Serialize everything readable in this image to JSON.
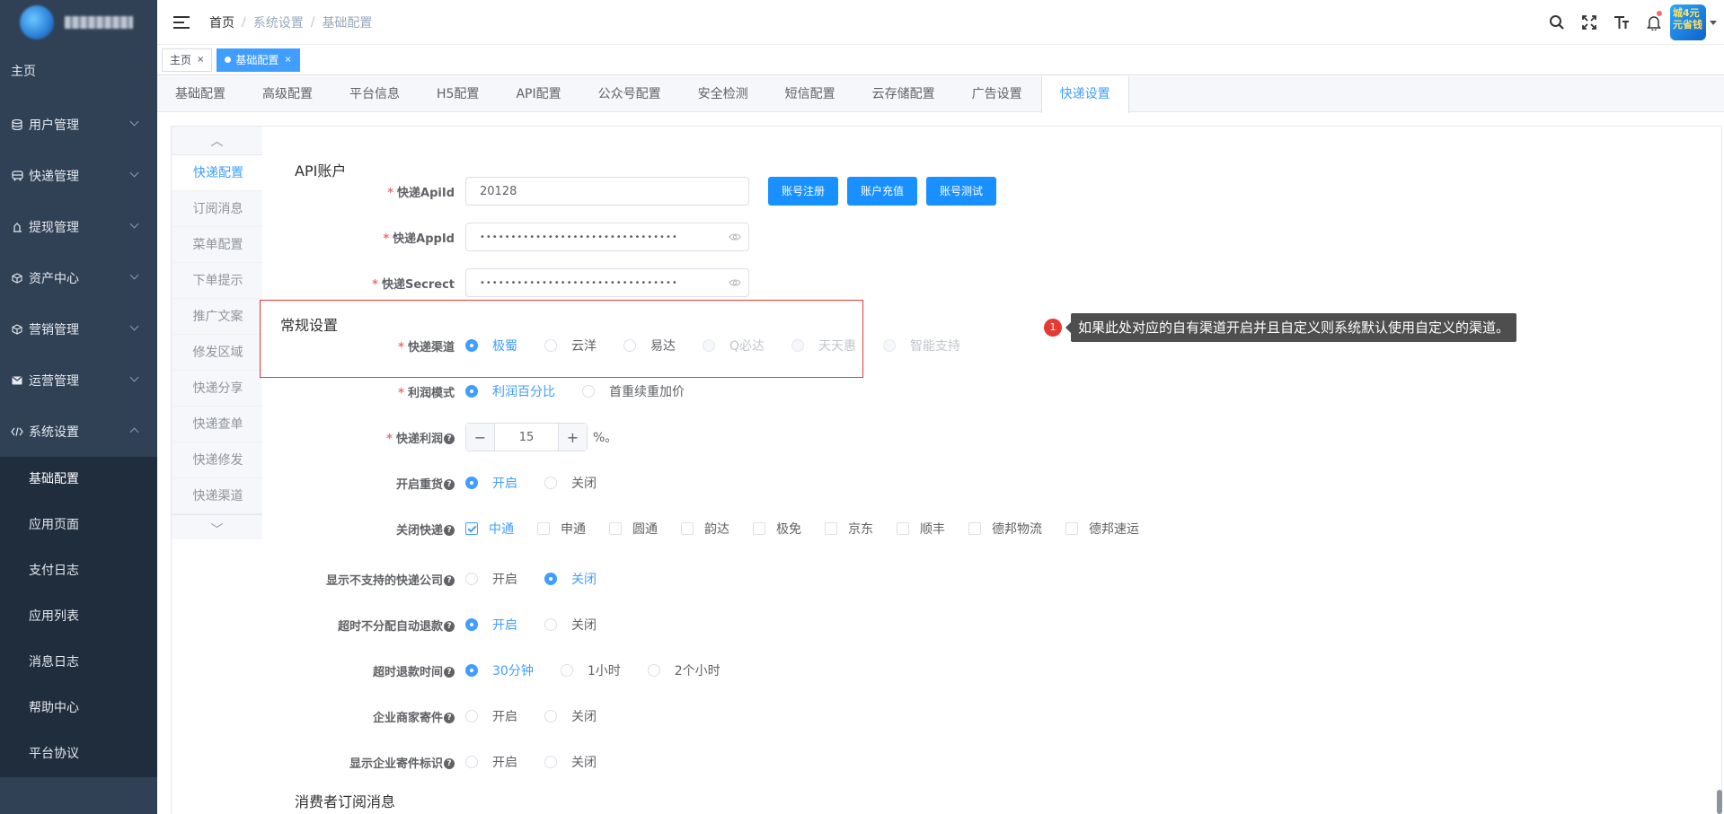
{
  "sidebar": {
    "home": "主页",
    "menu": [
      {
        "label": "用户管理",
        "icon": "database-icon"
      },
      {
        "label": "快递管理",
        "icon": "bus-icon"
      },
      {
        "label": "提现管理",
        "icon": "withdraw-icon"
      },
      {
        "label": "资产中心",
        "icon": "box-icon"
      },
      {
        "label": "营销管理",
        "icon": "box-icon"
      },
      {
        "label": "运营管理",
        "icon": "mail-icon"
      },
      {
        "label": "系统设置",
        "icon": "code-icon"
      }
    ],
    "submenu": [
      "基础配置",
      "应用页面",
      "支付日志",
      "应用列表",
      "消息日志",
      "帮助中心",
      "平台协议"
    ]
  },
  "breadcrumb": {
    "items": [
      "首页",
      "系统设置",
      "基础配置"
    ]
  },
  "avatar_text": "城4元 元省钱",
  "tags": {
    "home": "主页",
    "active": "基础配置"
  },
  "config_tabs": [
    "基础配置",
    "高级配置",
    "平台信息",
    "H5配置",
    "API配置",
    "公众号配置",
    "安全检测",
    "短信配置",
    "云存储配置",
    "广告设置",
    "快递设置"
  ],
  "active_config_tab": "快递设置",
  "vertical_tabs": [
    "快递配置",
    "订阅消息",
    "菜单配置",
    "下单提示",
    "推广文案",
    "修发区域",
    "快递分享",
    "快递查单",
    "快递修发",
    "快递渠道"
  ],
  "form": {
    "api_section": "API账户",
    "apiid_label": "快递ApiId",
    "apiid_value": "20128",
    "btn_register": "账号注册",
    "btn_recharge": "账户充值",
    "btn_test": "账号测试",
    "appid_label": "快递AppId",
    "appid_value": "••••••••••••••••••••••••••••••••",
    "secret_label": "快递Secrect",
    "secret_value": "••••••••••••••••••••••••••••••••",
    "general_section": "常规设置",
    "channel_label": "快递渠道",
    "channel_options": [
      "极蜀",
      "云洋",
      "易达",
      "Q必达",
      "天天惠",
      "智能支持"
    ],
    "channel_selected": "极蜀",
    "profit_mode_label": "利润模式",
    "profit_mode_options": [
      "利润百分比",
      "首重续重加价"
    ],
    "profit_label": "快递利润",
    "profit_value": "15",
    "profit_unit": "%。",
    "heavy_label": "开启重货",
    "heavy_options": [
      "开启",
      "关闭"
    ],
    "close_express_label": "关闭快递",
    "close_express_options": [
      "中通",
      "申通",
      "圆通",
      "韵达",
      "极免",
      "京东",
      "顺丰",
      "德邦物流",
      "德邦速运"
    ],
    "show_unsupported_label": "显示不支持的快递公司",
    "show_unsupported_options": [
      "开启",
      "关闭"
    ],
    "auto_refund_label": "超时不分配自动退款",
    "auto_refund_options": [
      "开启",
      "关闭"
    ],
    "refund_time_label": "超时退款时间",
    "refund_time_options": [
      "30分钟",
      "1小时",
      "2个小时"
    ],
    "merchant_label": "企业商家寄件",
    "merchant_options": [
      "开启",
      "关闭"
    ],
    "merchant_mark_label": "显示企业寄件标识",
    "merchant_mark_options": [
      "开启",
      "关闭"
    ],
    "consumer_section": "消费者订阅消息"
  },
  "annotation": {
    "number": "1",
    "text": "如果此处对应的自有渠道开启并且自定义则系统默认使用自定义的渠道。"
  },
  "colors": {
    "primary": "#409eff",
    "sidebar": "#304156",
    "highlight": "#e53935"
  }
}
